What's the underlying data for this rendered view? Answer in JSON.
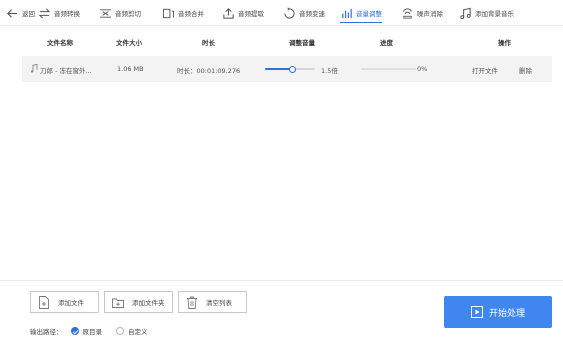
{
  "toolbar": {
    "back": "返回",
    "items": [
      {
        "label": "音频转换"
      },
      {
        "label": "音频剪切"
      },
      {
        "label": "音频合并"
      },
      {
        "label": "音频提取"
      },
      {
        "label": "音频变速"
      },
      {
        "label": "音量调整"
      },
      {
        "label": "噪声消除"
      },
      {
        "label": "添加背景音乐"
      }
    ],
    "active_index": 5
  },
  "table": {
    "headers": [
      "文件名称",
      "文件大小",
      "时长",
      "调整音量",
      "进度",
      "操作"
    ],
    "rows": [
      {
        "name": "刀郎 - 冻在窗外...",
        "size": "1.06 MB",
        "duration": "时长：00:01:09.276",
        "volume_label": "1.5倍",
        "volume_fraction": 0.55,
        "progress_label": "0%",
        "progress_fraction": 0.0,
        "action_open": "打开文件",
        "action_delete": "删除"
      }
    ]
  },
  "buttons": {
    "add_file": "添加文件",
    "add_folder": "添加文件夹",
    "clear_list": "清空列表",
    "start": "开始处理"
  },
  "output": {
    "label": "输出路径：",
    "option_original": "原目录",
    "option_custom": "自定义",
    "selected": "original"
  },
  "colors": {
    "accent": "#2f6fe0",
    "start_button": "#3f86ee",
    "row_bg": "#f3f3f3"
  }
}
